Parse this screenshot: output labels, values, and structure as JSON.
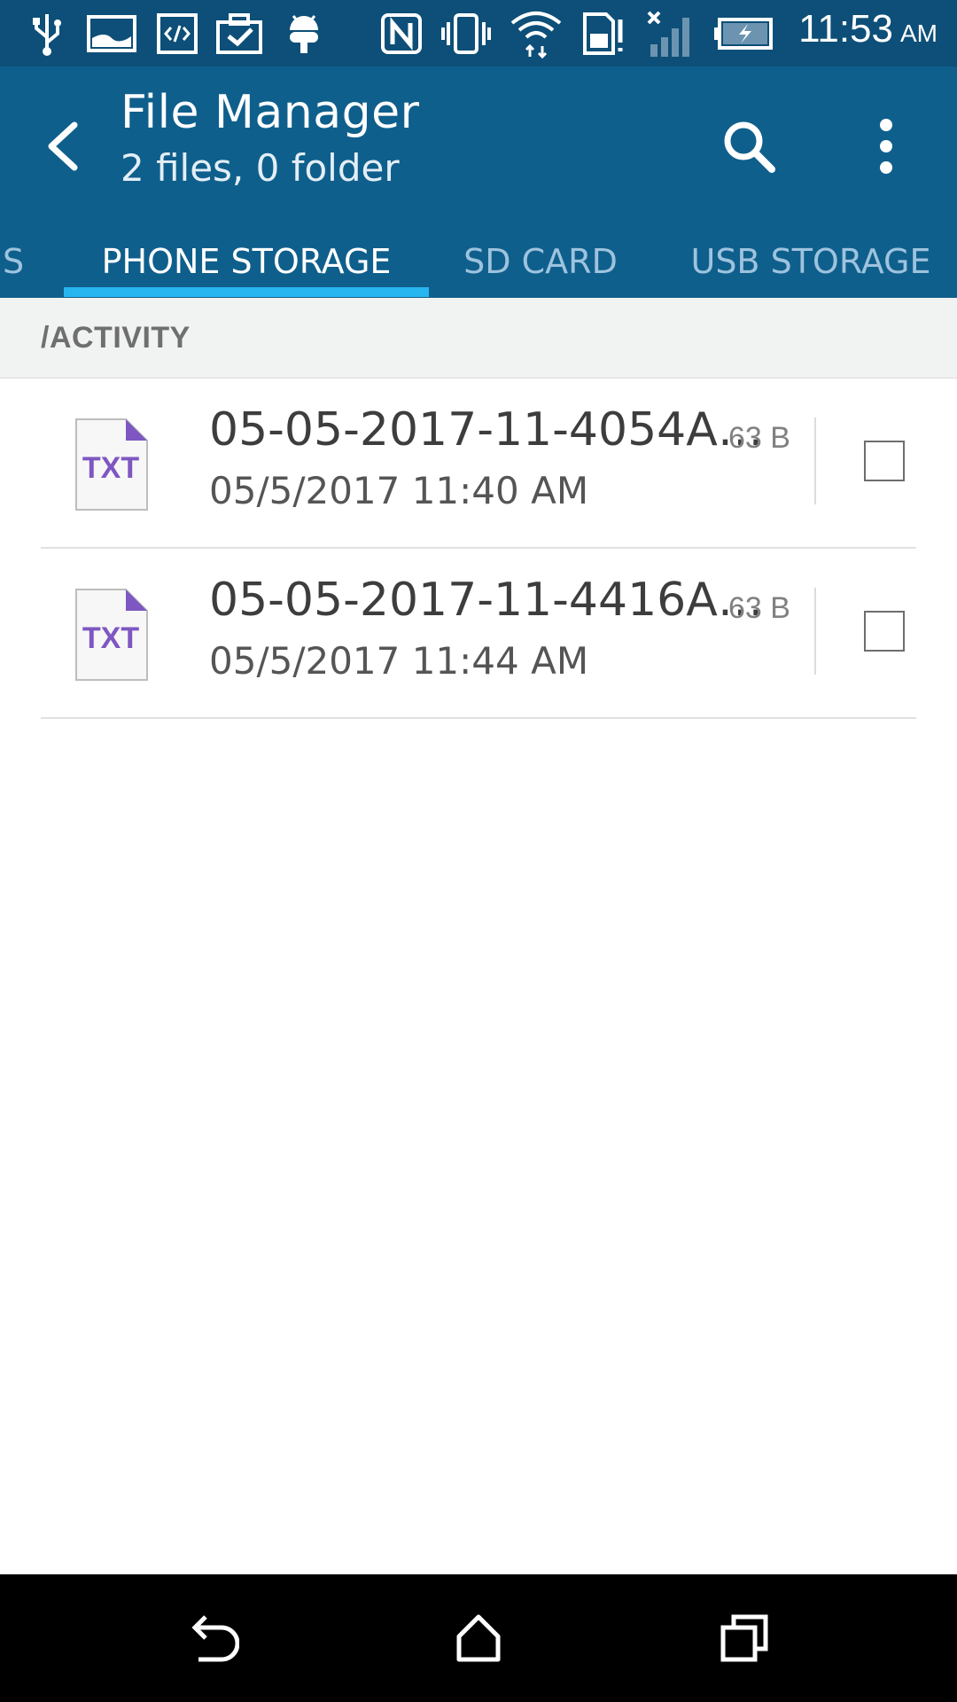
{
  "status_bar": {
    "time": "11:53",
    "ampm": "AM",
    "icons": [
      "usb-icon",
      "image-icon",
      "code-icon",
      "briefcase-check-icon",
      "android-icon",
      "nfc-icon",
      "vibrate-icon",
      "wifi-icon",
      "sim-icon",
      "signal-icon",
      "battery-charging-icon"
    ]
  },
  "app_bar": {
    "title": "File Manager",
    "subtitle": "2 files, 0 folder"
  },
  "tabs": [
    {
      "label": "S"
    },
    {
      "label": "PHONE STORAGE",
      "active": true
    },
    {
      "label": "SD CARD"
    },
    {
      "label": "USB STORAGE"
    }
  ],
  "path": "/ACTIVITY",
  "files": [
    {
      "icon_label": "TXT",
      "name": "05-05-2017-11-4054A…",
      "date": "05/5/2017 11:40 AM",
      "size": "63 B",
      "checked": false
    },
    {
      "icon_label": "TXT",
      "name": "05-05-2017-11-4416A…",
      "date": "05/5/2017 11:44 AM",
      "size": "63 B",
      "checked": false
    }
  ],
  "colors": {
    "status_bar": "#0d4f78",
    "app_bar": "#0f5f8c",
    "tab_indicator": "#27b5ef",
    "txt_accent": "#7e57c2"
  }
}
